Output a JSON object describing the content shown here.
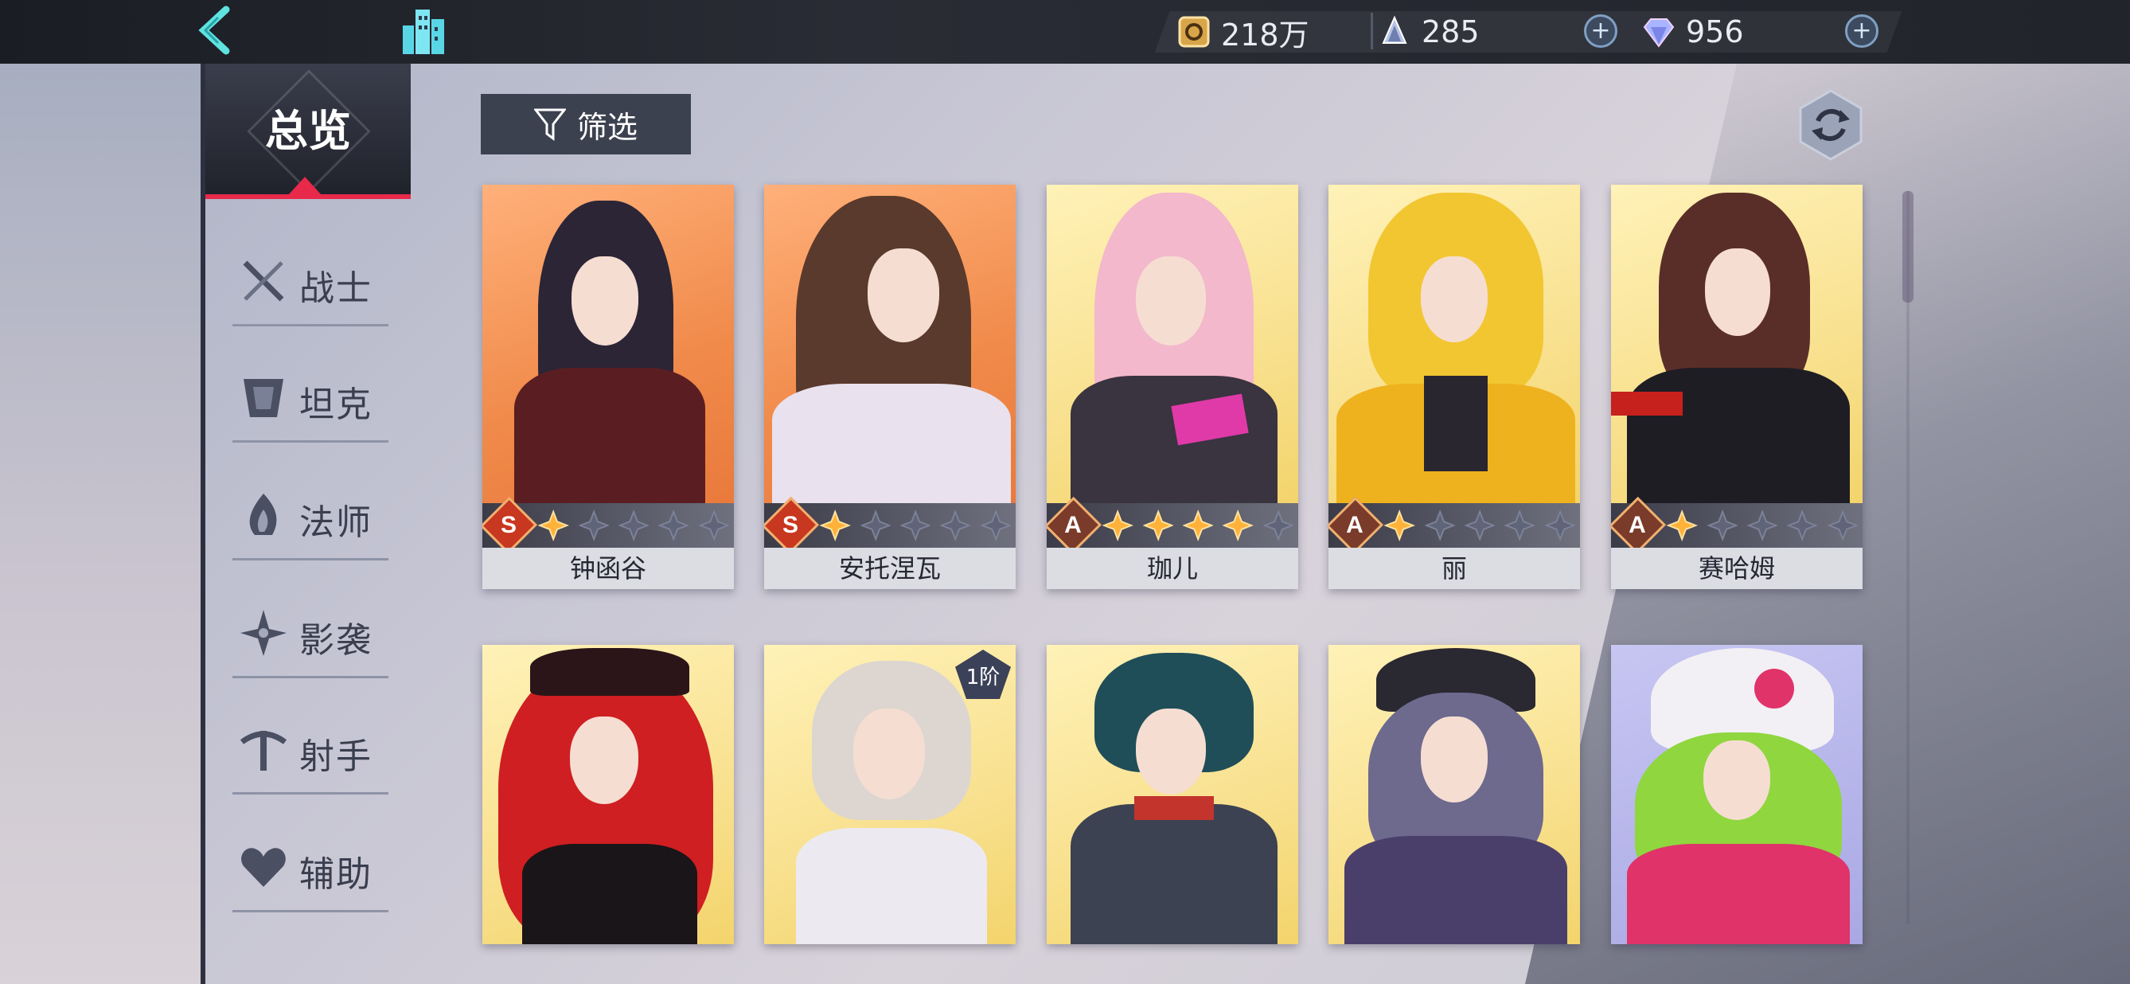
{
  "topbar": {
    "resources": [
      {
        "name": "gold",
        "value": "218万",
        "color": "#d9a54a"
      },
      {
        "name": "stamina",
        "value": "285",
        "color": "#b8c4e6"
      },
      {
        "name": "diamond",
        "value": "956",
        "color": "#a9b6ff"
      }
    ],
    "plus": "+"
  },
  "sidebar": {
    "overview": "总览",
    "items": [
      {
        "label": "战士",
        "icon": "crossed-swords-icon"
      },
      {
        "label": "坦克",
        "icon": "shield-icon"
      },
      {
        "label": "法师",
        "icon": "flame-icon"
      },
      {
        "label": "影袭",
        "icon": "shuriken-icon"
      },
      {
        "label": "射手",
        "icon": "crossbow-icon"
      },
      {
        "label": "辅助",
        "icon": "heart-icon"
      }
    ]
  },
  "toolbar": {
    "filter_label": "筛选"
  },
  "heroes_row1": [
    {
      "name": "钟函谷",
      "rank": "S",
      "stars": 1
    },
    {
      "name": "安托涅瓦",
      "rank": "S",
      "stars": 1
    },
    {
      "name": "珈儿",
      "rank": "A",
      "stars": 4
    },
    {
      "name": "丽",
      "rank": "A",
      "stars": 1
    },
    {
      "name": "赛哈姆",
      "rank": "A",
      "stars": 1
    }
  ],
  "heroes_row2": [
    {
      "badge": ""
    },
    {
      "badge": "1阶"
    },
    {
      "badge": ""
    },
    {
      "badge": ""
    },
    {
      "badge": ""
    }
  ],
  "accent_color": "#e8294a"
}
